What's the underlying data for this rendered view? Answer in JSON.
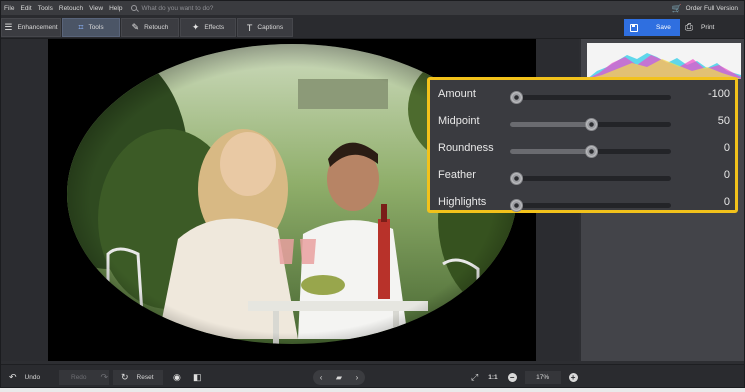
{
  "menu": {
    "items": [
      "File",
      "Edit",
      "Tools",
      "Retouch",
      "View",
      "Help"
    ],
    "search_placeholder": "What do you want to do?",
    "order_label": "Order Full Version"
  },
  "tabs": [
    {
      "label": "Enhancement",
      "icon": "sliders-icon"
    },
    {
      "label": "Tools",
      "icon": "crop-icon",
      "active": true
    },
    {
      "label": "Retouch",
      "icon": "brush-icon"
    },
    {
      "label": "Effects",
      "icon": "magic-wand-icon"
    },
    {
      "label": "Captions",
      "icon": "text-icon"
    }
  ],
  "actions": {
    "save_label": "Save",
    "print_label": "Print"
  },
  "vignette": {
    "sliders": [
      {
        "label": "Amount",
        "value": "-100",
        "position": 0.04
      },
      {
        "label": "Midpoint",
        "value": "50",
        "position": 0.5
      },
      {
        "label": "Roundness",
        "value": "0",
        "position": 0.5
      },
      {
        "label": "Feather",
        "value": "0",
        "position": 0.04
      },
      {
        "label": "Highlights",
        "value": "0",
        "position": 0.04
      }
    ]
  },
  "bottom": {
    "undo_label": "Undo",
    "redo_label": "Redo",
    "reset_label": "Reset",
    "actual_size_label": "1:1",
    "zoom_value": "17%"
  },
  "colors": {
    "accent": "#2f6fe0",
    "highlight_border": "#f2c21b"
  }
}
